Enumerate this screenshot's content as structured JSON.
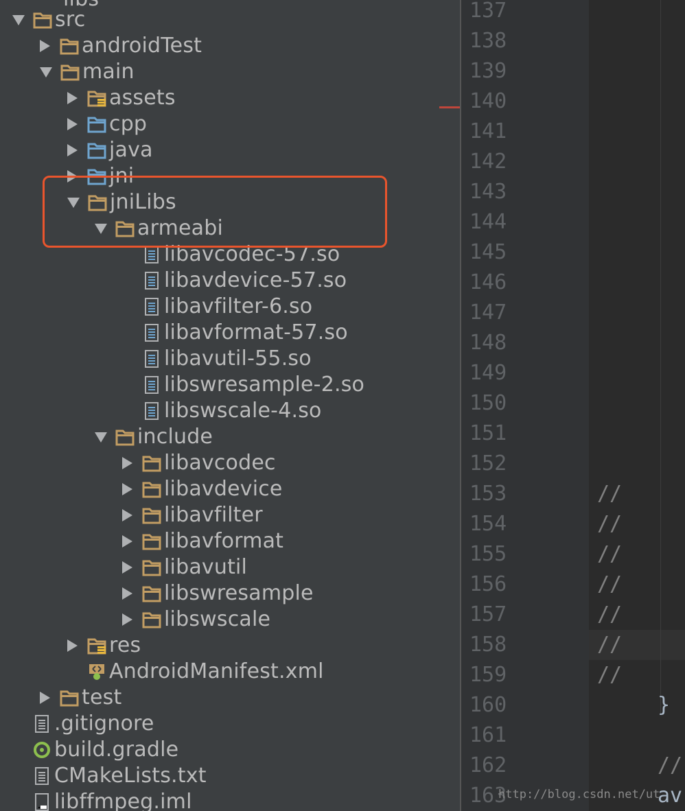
{
  "tree": {
    "partial_top_label": "libs",
    "items": [
      {
        "label": "src",
        "arrow": "down",
        "icon": "folder-icon",
        "indent": 0,
        "row": 0
      },
      {
        "label": "androidTest",
        "arrow": "right",
        "icon": "folder-icon",
        "indent": 1,
        "row": 1
      },
      {
        "label": "main",
        "arrow": "down",
        "icon": "folder-icon",
        "indent": 1,
        "row": 2
      },
      {
        "label": "assets",
        "arrow": "right",
        "icon": "resource-folder-icon",
        "indent": 2,
        "row": 3
      },
      {
        "label": "cpp",
        "arrow": "right",
        "icon": "source-folder-icon",
        "indent": 2,
        "row": 4
      },
      {
        "label": "java",
        "arrow": "right",
        "icon": "source-folder-icon",
        "indent": 2,
        "row": 5
      },
      {
        "label": "jni",
        "arrow": "right",
        "icon": "source-folder-icon",
        "indent": 2,
        "row": 6
      },
      {
        "label": "jniLibs",
        "arrow": "down",
        "icon": "folder-icon",
        "indent": 2,
        "row": 7
      },
      {
        "label": "armeabi",
        "arrow": "down",
        "icon": "folder-icon",
        "indent": 3,
        "row": 8
      },
      {
        "label": "libavcodec-57.so",
        "arrow": "none",
        "icon": "file-icon",
        "indent": 4,
        "row": 9
      },
      {
        "label": "libavdevice-57.so",
        "arrow": "none",
        "icon": "file-icon",
        "indent": 4,
        "row": 10
      },
      {
        "label": "libavfilter-6.so",
        "arrow": "none",
        "icon": "file-icon",
        "indent": 4,
        "row": 11
      },
      {
        "label": "libavformat-57.so",
        "arrow": "none",
        "icon": "file-icon",
        "indent": 4,
        "row": 12
      },
      {
        "label": "libavutil-55.so",
        "arrow": "none",
        "icon": "file-icon",
        "indent": 4,
        "row": 13
      },
      {
        "label": "libswresample-2.so",
        "arrow": "none",
        "icon": "file-icon",
        "indent": 4,
        "row": 14
      },
      {
        "label": "libswscale-4.so",
        "arrow": "none",
        "icon": "file-icon",
        "indent": 4,
        "row": 15
      },
      {
        "label": "include",
        "arrow": "down",
        "icon": "folder-icon",
        "indent": 3,
        "row": 16
      },
      {
        "label": "libavcodec",
        "arrow": "right",
        "icon": "folder-icon",
        "indent": 4,
        "row": 17
      },
      {
        "label": "libavdevice",
        "arrow": "right",
        "icon": "folder-icon",
        "indent": 4,
        "row": 18
      },
      {
        "label": "libavfilter",
        "arrow": "right",
        "icon": "folder-icon",
        "indent": 4,
        "row": 19
      },
      {
        "label": "libavformat",
        "arrow": "right",
        "icon": "folder-icon",
        "indent": 4,
        "row": 20
      },
      {
        "label": "libavutil",
        "arrow": "right",
        "icon": "folder-icon",
        "indent": 4,
        "row": 21
      },
      {
        "label": "libswresample",
        "arrow": "right",
        "icon": "folder-icon",
        "indent": 4,
        "row": 22
      },
      {
        "label": "libswscale",
        "arrow": "right",
        "icon": "folder-icon",
        "indent": 4,
        "row": 23
      },
      {
        "label": "res",
        "arrow": "right",
        "icon": "resource-folder-icon",
        "indent": 2,
        "row": 24
      },
      {
        "label": "AndroidManifest.xml",
        "arrow": "none",
        "icon": "manifest-icon",
        "indent": 2,
        "row": 25
      },
      {
        "label": "test",
        "arrow": "right",
        "icon": "folder-icon",
        "indent": 1,
        "row": 26
      },
      {
        "label": ".gitignore",
        "arrow": "none",
        "icon": "text-file-icon",
        "indent": 0,
        "row": 27
      },
      {
        "label": "build.gradle",
        "arrow": "none",
        "icon": "gradle-icon",
        "indent": 0,
        "row": 28
      },
      {
        "label": "CMakeLists.txt",
        "arrow": "none",
        "icon": "text-file-icon",
        "indent": 0,
        "row": 29
      },
      {
        "label": "libffmpeg.iml",
        "arrow": "none",
        "icon": "iml-file-icon",
        "indent": 0,
        "row": 30
      }
    ]
  },
  "gutter": {
    "line_numbers": [
      "137",
      "138",
      "139",
      "140",
      "141",
      "142",
      "143",
      "144",
      "145",
      "146",
      "147",
      "148",
      "149",
      "150",
      "151",
      "152",
      "153",
      "154",
      "155",
      "156",
      "157",
      "158",
      "159",
      "160",
      "161",
      "162",
      "163"
    ]
  },
  "editor": {
    "comment_marker": "//",
    "comment_lines": [
      "153",
      "154",
      "155",
      "156",
      "157",
      "158",
      "159"
    ],
    "brace_line": {
      "line": "160",
      "text": "}"
    },
    "line_162_text": "//",
    "line_163_text": "av"
  },
  "watermark": "http://blog.csdn.net/ut",
  "colors": {
    "panel_bg": "#3c3f41",
    "editor_bg": "#2b2b2b",
    "gutter_bg": "#313335",
    "highlight_border": "#e9552d",
    "folder": "#c29d63",
    "source_folder": "#6fa5cf",
    "text": "#bbbbbb"
  }
}
